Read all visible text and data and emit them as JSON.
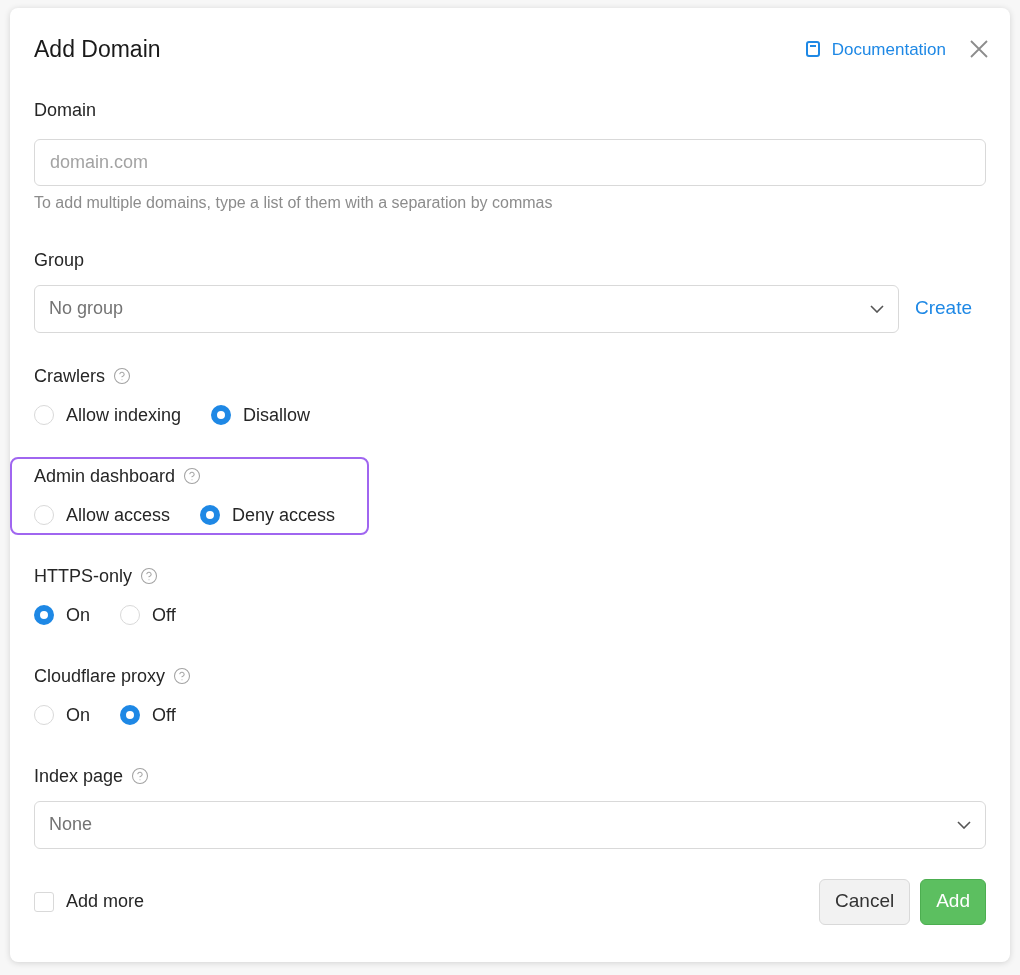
{
  "dialog": {
    "title": "Add Domain",
    "documentation_link": "Documentation"
  },
  "fields": [
    {
      "kind": "text_input",
      "label": "Domain",
      "placeholder": "domain.com",
      "hint": "To add multiple domains, type a list of them with a separation by commas"
    },
    {
      "kind": "select",
      "label": "Group",
      "value": "No group",
      "action": "Create"
    },
    {
      "kind": "radio_group",
      "label": "Crawlers",
      "help": true,
      "highlighted": false,
      "options": [
        {
          "label": "Allow indexing",
          "selected": false
        },
        {
          "label": "Disallow",
          "selected": true
        }
      ]
    },
    {
      "kind": "radio_group",
      "label": "Admin dashboard",
      "help": true,
      "highlighted": true,
      "options": [
        {
          "label": "Allow access",
          "selected": false
        },
        {
          "label": "Deny access",
          "selected": true
        }
      ]
    },
    {
      "kind": "radio_group",
      "label": "HTTPS-only",
      "help": true,
      "highlighted": false,
      "options": [
        {
          "label": "On",
          "selected": true
        },
        {
          "label": "Off",
          "selected": false
        }
      ]
    },
    {
      "kind": "radio_group",
      "label": "Cloudflare proxy",
      "help": true,
      "highlighted": false,
      "options": [
        {
          "label": "On",
          "selected": false
        },
        {
          "label": "Off",
          "selected": true
        }
      ]
    },
    {
      "kind": "select",
      "label": "Index page",
      "help": true,
      "value": "None"
    }
  ],
  "footer": {
    "checkbox": {
      "label": "Add more",
      "checked": false
    },
    "buttons": [
      {
        "kind": "secondary",
        "label": "Cancel"
      },
      {
        "kind": "primary",
        "label": "Add"
      }
    ]
  }
}
